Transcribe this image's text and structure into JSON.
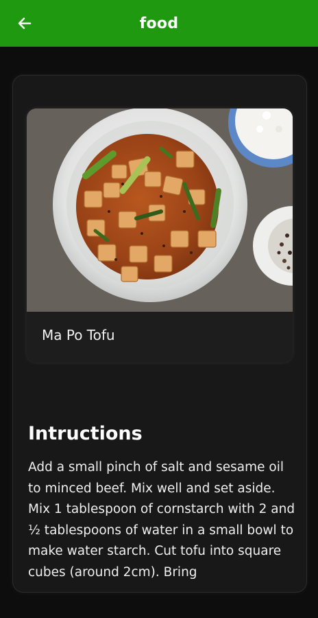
{
  "app_bar": {
    "title": "food",
    "back_icon": "arrow-left-icon",
    "background_color": "#1f9a10"
  },
  "recipe": {
    "name": "Ma Po Tofu",
    "image_alt": "bowl of ma po tofu with scallions, rice and peppercorns"
  },
  "instructions": {
    "title": "Intructions",
    "text": "Add a small pinch of salt and sesame oil to minced beef. Mix well and set aside. Mix 1 tablespoon of cornstarch with 2 and ½ tablespoons of water in a small bowl to make water starch. Cut tofu into square cubes (around 2cm). Bring"
  },
  "theme": {
    "page_background": "#0d0d0d",
    "panel_background": "#181818",
    "text_color": "#ffffff"
  }
}
